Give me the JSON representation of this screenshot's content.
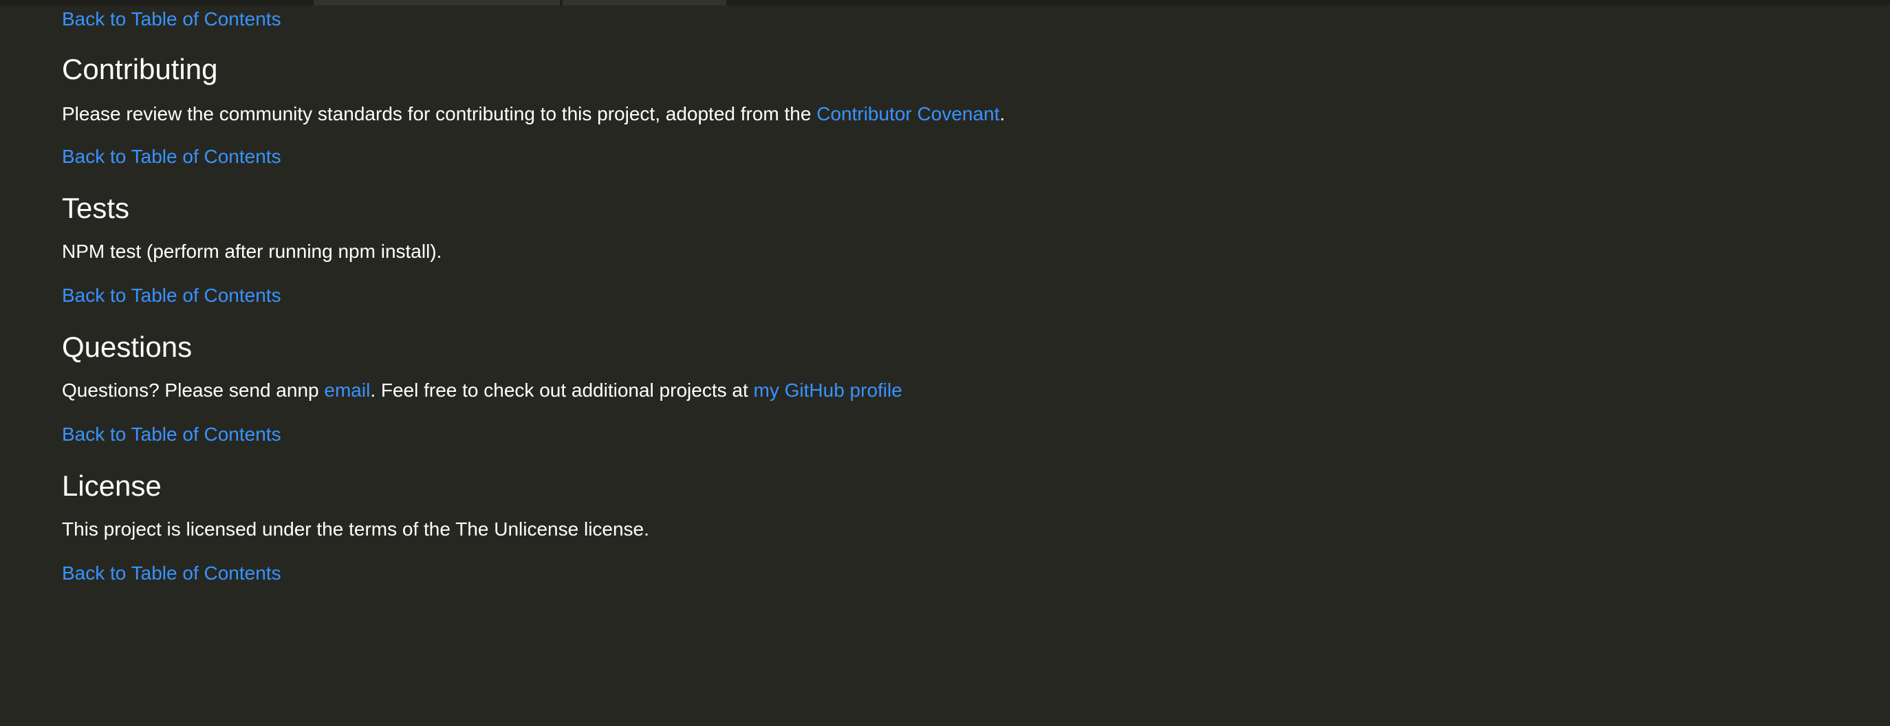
{
  "top_link": "Back to Table of Contents",
  "sections": [
    {
      "heading": "Contributing",
      "text_before": "Please review the community standards for contributing to this project, adopted from the ",
      "link": "Contributor Covenant",
      "text_after": ".",
      "back_link": "Back to Table of Contents"
    },
    {
      "heading": "Tests",
      "text": "NPM test (perform after running npm install).",
      "back_link": "Back to Table of Contents"
    },
    {
      "heading": "Questions",
      "text_before": "Questions? Please send annp ",
      "link1": "email",
      "text_middle": ". Feel free to check out additional projects at ",
      "link2": "my GitHub profile",
      "back_link": "Back to Table of Contents"
    },
    {
      "heading": "License",
      "text": "This project is licensed under the terms of the The Unlicense license.",
      "back_link": "Back to Table of Contents"
    }
  ],
  "colors": {
    "background": "#272722",
    "text": "#ffffff",
    "link": "#3794ff"
  }
}
